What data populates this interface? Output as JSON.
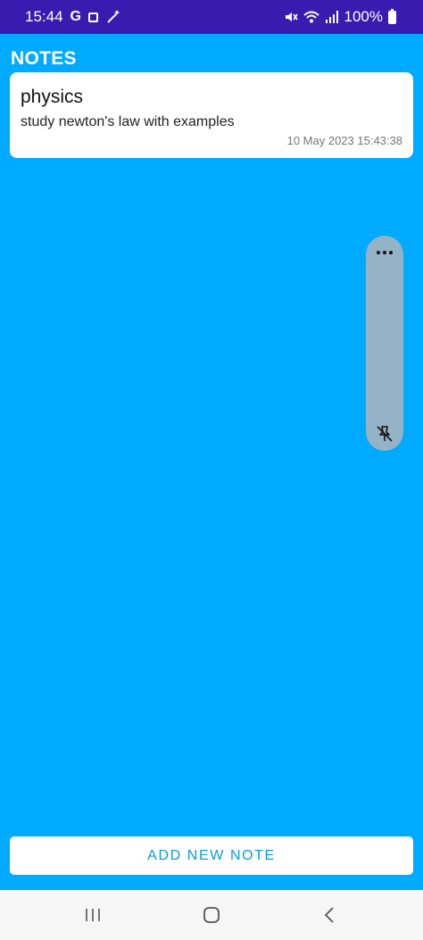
{
  "status_bar": {
    "time": "15:44",
    "left_icons": [
      "google-icon",
      "screen-recorder-icon",
      "magic-wand-icon"
    ],
    "right_icons": [
      "mute-icon",
      "wifi-icon",
      "signal-icon"
    ],
    "battery": "100%"
  },
  "app": {
    "title": "NOTES"
  },
  "notes": [
    {
      "title": "physics",
      "body": "study newton's law with examples",
      "date": "10 May 2023 15:43:38"
    }
  ],
  "floating_panel": {
    "icons": [
      "more-horizontal-icon",
      "pin-off-icon"
    ]
  },
  "actions": {
    "add_new_note": "ADD NEW NOTE"
  },
  "nav_bar": {
    "items": [
      "recents-icon",
      "home-icon",
      "back-icon"
    ]
  },
  "colors": {
    "background": "#00aaff",
    "status_bar": "#3a1bb0",
    "accent_text": "#0a9bd6",
    "panel": "#94b3c6"
  }
}
